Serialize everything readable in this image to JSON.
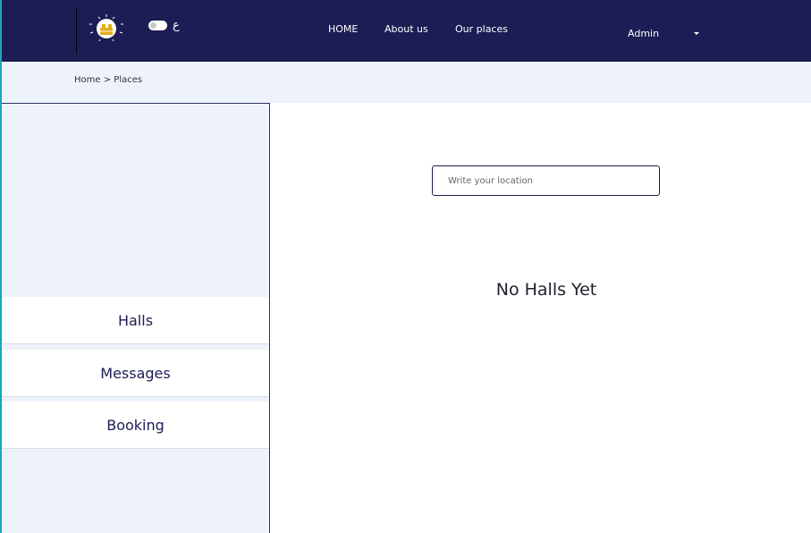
{
  "header": {
    "logo_icon": "lightbulb-logo-icon",
    "lang_toggle_label": "ع",
    "nav": [
      {
        "label": "HOME"
      },
      {
        "label": "About us"
      },
      {
        "label": "Our places"
      }
    ],
    "user": {
      "label": "Admin",
      "dropdown_icon": "caret-down-icon"
    }
  },
  "breadcrumb": {
    "items": [
      "Home",
      "Places"
    ],
    "separator": ">"
  },
  "sidebar": {
    "items": [
      {
        "label": "Halls"
      },
      {
        "label": "Messages"
      },
      {
        "label": "Booking"
      }
    ]
  },
  "main": {
    "search": {
      "placeholder": "Write your location",
      "value": ""
    },
    "empty_message": "No Halls Yet"
  },
  "colors": {
    "header_bg": "#1b1d54",
    "crumb_bg": "#eef3fb",
    "accent": "#1aa7b8",
    "logo_yellow": "#e0b020"
  }
}
